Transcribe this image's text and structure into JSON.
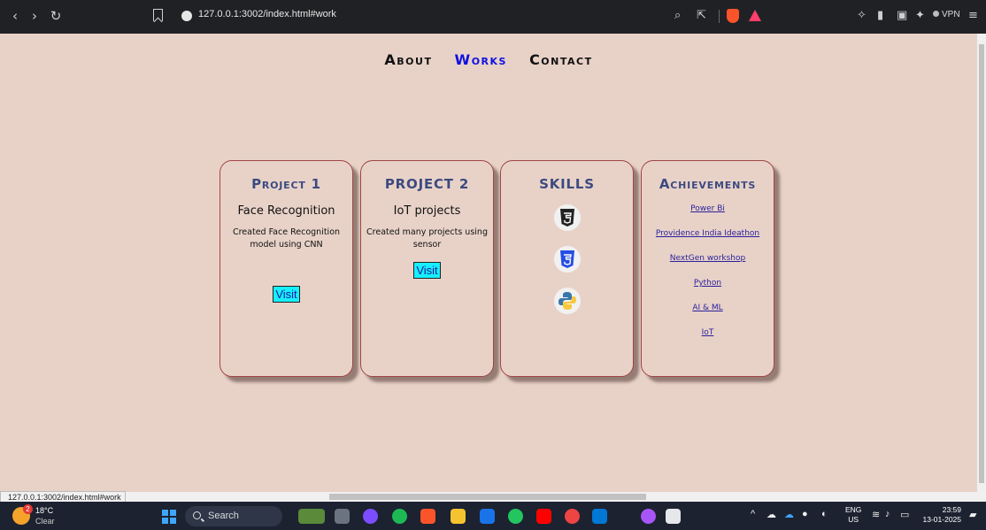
{
  "browser": {
    "url": "127.0.0.1:3002/index.html#work",
    "vpn_label": "VPN"
  },
  "nav": {
    "items": [
      {
        "label": "About",
        "active": false
      },
      {
        "label": "Works",
        "active": true
      },
      {
        "label": "Contact",
        "active": false
      }
    ]
  },
  "cards": {
    "project1": {
      "title": "Project 1",
      "subtitle": "Face Recognition",
      "description": "Created Face Recognition model using CNN",
      "button": "Visit"
    },
    "project2": {
      "title": "PROJECT 2",
      "subtitle": "IoT projects",
      "description": "Created many projects using sensor",
      "button": "Visit"
    },
    "skills": {
      "title": "SKILLS",
      "icons": [
        "html5-icon",
        "css3-icon",
        "python-icon"
      ]
    },
    "achievements": {
      "title": "Achievements",
      "links": [
        "Power Bi",
        "Providence India Ideathon",
        "NextGen workshop",
        "Python",
        "AI & ML",
        "IoT"
      ]
    }
  },
  "status_bar": {
    "url": "127.0.0.1:3002/index.html#work"
  },
  "taskbar": {
    "weather_badge": "2",
    "temperature": "18°C",
    "condition": "Clear",
    "search_label": "Search",
    "language_1": "ENG",
    "language_2": "US",
    "time": "23:59",
    "date": "13-01-2025"
  },
  "colors": {
    "page_bg": "#e8d2c8",
    "nav_active": "#1010e0",
    "card_title": "#3d4a80",
    "visit_button": "#16f0ff",
    "card_border": "#a04545"
  }
}
